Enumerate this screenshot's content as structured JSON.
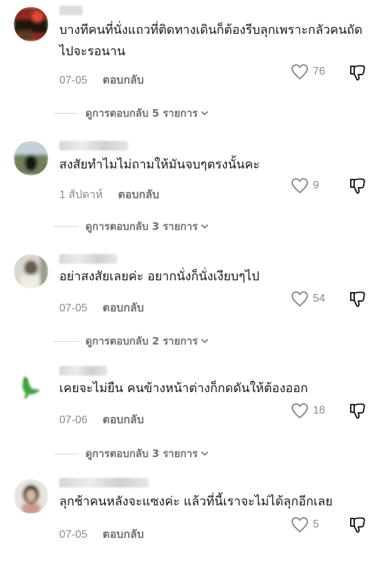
{
  "comments": [
    {
      "text": "บางทีคนที่นั่งแถวที่ติดทางเดินก็ต้องรีบลุกเพราะกลัวคนถัดไปจะรอนาน",
      "date": "07-05",
      "reply_label": "ตอบกลับ",
      "likes": "76",
      "view_replies": "ดูการตอบกลับ 5 รายการ"
    },
    {
      "text": "สงสัยทำไมไม่ถามให้มันจบๆตรงนั้นคะ",
      "date": "1 สัปดาห์",
      "reply_label": "ตอบกลับ",
      "likes": "9",
      "view_replies": "ดูการตอบกลับ 3 รายการ"
    },
    {
      "text": "อย่าสงสัยเลยค่ะ อยากนั่งก็นั่งเงียบๆไป",
      "date": "07-05",
      "reply_label": "ตอบกลับ",
      "likes": "54",
      "view_replies": "ดูการตอบกลับ 2 รายการ"
    },
    {
      "text": "เคยจะไม่ยืน คนข้างหน้าต่างก็กดดันให้ต้องออก",
      "date": "07-06",
      "reply_label": "ตอบกลับ",
      "likes": "18",
      "view_replies": "ดูการตอบกลับ 3 รายการ"
    },
    {
      "text": "ลุกช้าคนหลังจะแซงค่ะ แล้วที่นี้เราจะไม่ได้ลุกอีกเลย",
      "date": "07-05",
      "reply_label": "ตอบกลับ",
      "likes": "5"
    }
  ],
  "icons": {
    "like": "heart-outline-icon",
    "dislike": "thumbs-down-outline-icon",
    "expand": "chevron-down-icon"
  },
  "colors": {
    "text": "#161823",
    "meta": "#8a8b91",
    "divider": "#d5d5d8"
  }
}
